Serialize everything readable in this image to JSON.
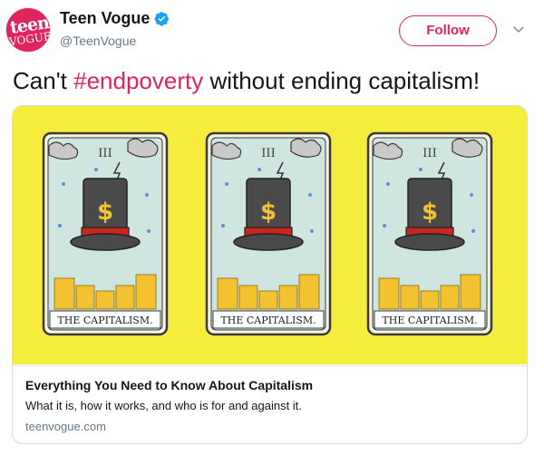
{
  "account": {
    "name": "Teen Vogue",
    "handle": "@TeenVogue",
    "avatar_text_line1": "teen",
    "avatar_text_line2": "VOGUE",
    "verified_icon": "verified-badge-icon"
  },
  "actions": {
    "follow_label": "Follow",
    "menu_icon": "chevron-down-icon"
  },
  "tweet": {
    "text_before": "Can't ",
    "hashtag": "#endpoverty",
    "text_after": " without ending capitalism!"
  },
  "card": {
    "tarot_numeral": "III",
    "tarot_caption": "THE CAPITALISM.",
    "title": "Everything You Need to Know About Capitalism",
    "description": "What it is, how it works, and who is for and against it.",
    "domain": "teenvogue.com"
  },
  "colors": {
    "brand": "#e0245e",
    "verified": "#1da1f2",
    "card_bg": "#f5ec3c",
    "hat": "#4a4a4a",
    "hat_band": "#c8281e",
    "coins": "#f2c230"
  }
}
